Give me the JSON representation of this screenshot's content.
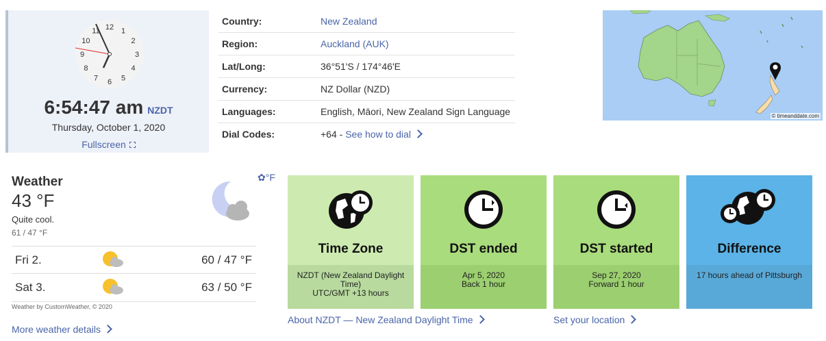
{
  "clock": {
    "time": "6:54:47 am",
    "tz_abbr": "NZDT",
    "date": "Thursday, October 1, 2020",
    "fullscreen_label": "Fullscreen",
    "fullscreen_icon": "expand-icon",
    "dial_numbers": [
      "12",
      "1",
      "2",
      "3",
      "4",
      "5",
      "6",
      "7",
      "8",
      "9",
      "10",
      "11"
    ]
  },
  "info": {
    "rows": [
      {
        "label": "Country:",
        "value": "New Zealand",
        "link": true
      },
      {
        "label": "Region:",
        "value": "Auckland (AUK)",
        "link": true
      },
      {
        "label": "Lat/Long:",
        "value": "36°51'S / 174°46'E",
        "link": false
      },
      {
        "label": "Currency:",
        "value": "NZ Dollar (NZD)",
        "link": false
      },
      {
        "label": "Languages:",
        "value": "English, Māori, New Zealand Sign Language",
        "link": false
      },
      {
        "label": "Dial Codes:",
        "value": "+64 -",
        "link": false,
        "extra_link": "See how to dial"
      }
    ]
  },
  "map": {
    "credit": "© timeanddate.com",
    "pin_icon": "location-pin-icon"
  },
  "weather": {
    "title": "Weather",
    "temp": "43 °F",
    "desc": "Quite cool.",
    "hilo": "61 / 47 °F",
    "unit_toggle": "°F",
    "unit_icon": "gear-icon",
    "current_icon": "night-cloud-icon",
    "forecast": [
      {
        "day": "Fri 2.",
        "temps": "60 / 47 °F",
        "icon": "partly-sunny-icon"
      },
      {
        "day": "Sat 3.",
        "temps": "63 / 50 °F",
        "icon": "partly-sunny-icon"
      }
    ],
    "credit": "Weather by CustomWeather, © 2020",
    "more_link": "More weather details"
  },
  "tiles": [
    {
      "title": "Time Zone",
      "lines": [
        "NZDT (New Zealand Daylight Time)",
        "UTC/GMT +13 hours"
      ],
      "icon": "globe-clock-icon",
      "color": "#cdebb0"
    },
    {
      "title": "DST ended",
      "lines": [
        "Apr 5, 2020",
        "Back 1 hour"
      ],
      "icon": "clock-back-icon",
      "color": "#a9dc7c"
    },
    {
      "title": "DST started",
      "lines": [
        "Sep 27, 2020",
        "Forward 1 hour"
      ],
      "icon": "clock-forward-icon",
      "color": "#a9dc7c"
    },
    {
      "title": "Difference",
      "lines": [
        "17 hours ahead of Pittsburgh"
      ],
      "icon": "globes-clocks-icon",
      "color": "#5bb3e8"
    }
  ],
  "links": {
    "about": "About NZDT — New Zealand Daylight Time",
    "set_location": "Set your location"
  }
}
